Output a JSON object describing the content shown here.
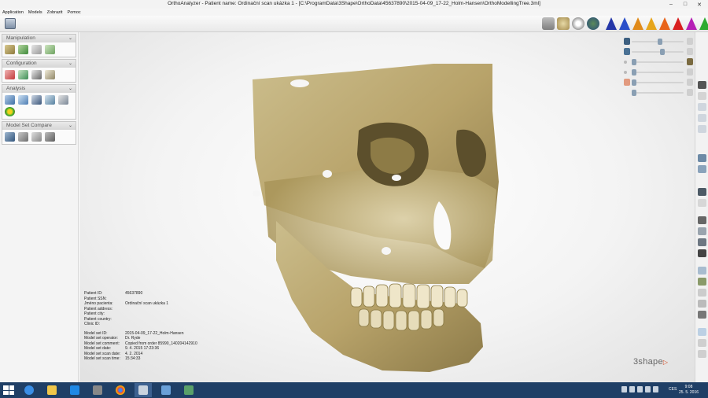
{
  "window": {
    "title": "OrthoAnalyzer - Patient name:  Ordinační scan ukázka 1 - [C:\\ProgramData\\3Shape\\OrthoData\\45637890\\2015-04-09_17-22_Holm-Hansen\\OrthoModellingTree.3ml]",
    "minimize": "–",
    "maximize": "□",
    "close": "✕"
  },
  "menu": {
    "items": [
      "Application",
      "Models",
      "Zobrazit",
      "Pomoc"
    ]
  },
  "sidebar": {
    "collapse_glyph": "⌄",
    "sections": [
      {
        "title": "Manipulation",
        "tools": [
          "move-model-icon",
          "rotate-model-icon",
          "dental-chain-icon",
          "occlusion-icon"
        ]
      },
      {
        "title": "Configuration",
        "tools": [
          "axis-setup-icon",
          "bite-config-icon",
          "measure-config-icon",
          "tooth-config-icon"
        ]
      },
      {
        "title": "Analysis",
        "tools": [
          "ruler-icon",
          "chart-analysis-icon",
          "angle-analysis-icon",
          "arch-analysis-icon",
          "report-icon",
          "color-map-icon"
        ]
      },
      {
        "title": "Model Set Compare",
        "tools": [
          "compare-set-icon",
          "superimpose-icon",
          "link-icon",
          "difference-icon"
        ]
      }
    ]
  },
  "patient_info": [
    {
      "label": "Patient ID:",
      "value": "45637890"
    },
    {
      "label": "Patient SSN:",
      "value": ""
    },
    {
      "label": "Jméno pacienta:",
      "value": "Ordinační scan ukázka 1"
    },
    {
      "label": "Patient address:",
      "value": ""
    },
    {
      "label": "Patient city:",
      "value": ""
    },
    {
      "label": "Patient country:",
      "value": ""
    },
    {
      "label": "Clinic ID:",
      "value": ""
    }
  ],
  "model_info": [
    {
      "label": "Model set ID:",
      "value": "2015-04-09_17-22_Holm-Hansen"
    },
    {
      "label": "Model set operator:",
      "value": "Dr. Ryde"
    },
    {
      "label": "Model set comment:",
      "value": "Copied from order 85990_140204142910"
    },
    {
      "label": "Model set date:",
      "value": "9. 4. 2015 17:23:36"
    },
    {
      "label": "Model set scan date:",
      "value": "4. 2. 2014"
    },
    {
      "label": "Model set scan time:",
      "value": "15:34:33"
    }
  ],
  "brand": {
    "text": "3shape",
    "mark": "▷"
  },
  "display_sliders": [
    {
      "name": "cbct-opacity",
      "value": 0.55
    },
    {
      "name": "model-opacity",
      "value": 0.6
    },
    {
      "name": "tooth-visibility",
      "value": 0.0
    },
    {
      "name": "threshold",
      "value": 0.0
    },
    {
      "name": "color-level",
      "value": 0.0
    },
    {
      "name": "skin-opacity",
      "value": 0.0
    }
  ],
  "toolbar": {
    "view_buttons": [
      "gray-view-icon",
      "texture-view-icon",
      "bite-view-icon",
      "rotate-view-icon"
    ],
    "color_triangles": [
      "#2436a8",
      "#2b4fc9",
      "#e08a1a",
      "#e6a51b",
      "#e8641b",
      "#d81f1f",
      "#b51fb5",
      "#2faa2f"
    ]
  },
  "colors": {
    "bone": "#c9b98a",
    "accent": "#3d6190"
  },
  "taskbar": {
    "apps": [
      "ie-icon",
      "file-explorer-icon",
      "teamviewer-icon",
      "camera-icon",
      "chrome-icon",
      "orthoanalyzer-icon",
      "image-viewer-icon",
      "scan-icon"
    ],
    "lang": "CES",
    "time": "9:08",
    "date": "25. 5. 2016"
  }
}
